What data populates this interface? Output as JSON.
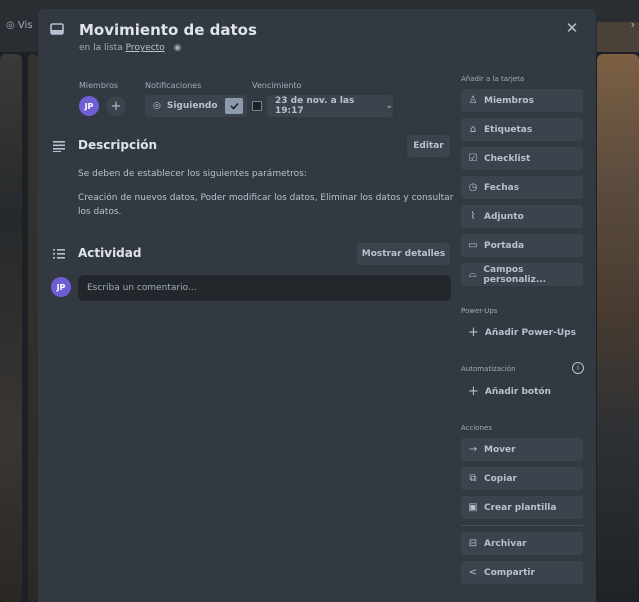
{
  "background": {
    "top_partial_text": "Vis"
  },
  "card": {
    "title": "Movimiento de datos",
    "list_prefix": "en la lista",
    "list_name": "Proyecto"
  },
  "members": {
    "label": "Miembros",
    "avatar_initials": "JP",
    "add_symbol": "+"
  },
  "notifications": {
    "label": "Notificaciones",
    "button_label": "Siguiendo",
    "checked": true
  },
  "due": {
    "label": "Vencimiento",
    "value": "23 de nov. a las 19:17"
  },
  "description": {
    "heading": "Descripción",
    "edit_label": "Editar",
    "line1": "Se deben de establecer los siguientes parámetros:",
    "line2": "Creación de nuevos datos, Poder modificar los datos, Eliminar los datos y consultar",
    "line3": "los datos."
  },
  "activity": {
    "heading": "Actividad",
    "details_label": "Mostrar detalles",
    "avatar_initials": "JP",
    "comment_placeholder": "Escriba un comentario..."
  },
  "sidebar": {
    "add_to_card_label": "Añadir a la tarjeta",
    "add_items": [
      {
        "label": "Miembros",
        "icon": "person-icon"
      },
      {
        "label": "Etiquetas",
        "icon": "tag-icon"
      },
      {
        "label": "Checklist",
        "icon": "checkbox-icon"
      },
      {
        "label": "Fechas",
        "icon": "clock-icon"
      },
      {
        "label": "Adjunto",
        "icon": "paperclip-icon"
      },
      {
        "label": "Portada",
        "icon": "cover-icon"
      },
      {
        "label": "Campos personaliz...",
        "icon": "custom-fields-icon"
      }
    ],
    "powerups_label": "Power-Ups",
    "add_powerups": "Añadir Power-Ups",
    "automation_label": "Automatización",
    "add_button": "Añadir botón",
    "actions_label": "Acciones",
    "actions": [
      {
        "label": "Mover",
        "icon": "arrow-right-icon"
      },
      {
        "label": "Copiar",
        "icon": "copy-icon"
      },
      {
        "label": "Crear plantilla",
        "icon": "template-icon"
      },
      {
        "label": "Archivar",
        "icon": "archive-icon"
      },
      {
        "label": "Compartir",
        "icon": "share-icon"
      }
    ]
  },
  "colors": {
    "modal_bg": "#323940",
    "button_bg": "#3b444c",
    "avatar_bg": "#6f5ed6",
    "text_primary": "#dfe4ea",
    "text_secondary": "#9fadbc"
  }
}
